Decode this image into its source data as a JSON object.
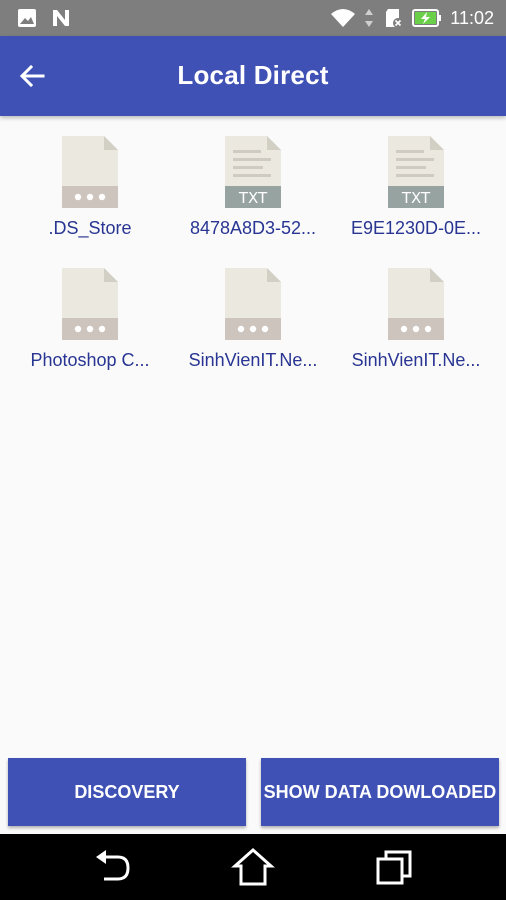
{
  "status_bar": {
    "time": "11:02",
    "icons": [
      "gallery-icon",
      "n-notification-icon",
      "wifi-icon",
      "data-arrows-icon",
      "sd-card-icon",
      "battery-charging-icon"
    ]
  },
  "app_bar": {
    "title": "Local Direct",
    "back_icon": "arrow-back-icon"
  },
  "files": [
    {
      "name": ".DS_Store",
      "type": "generic"
    },
    {
      "name": "8478A8D3-52...",
      "type": "txt",
      "badge": "TXT"
    },
    {
      "name": "E9E1230D-0E...",
      "type": "txt",
      "badge": "TXT"
    },
    {
      "name": "Photoshop C...",
      "type": "generic"
    },
    {
      "name": "SinhVienIT.Ne...",
      "type": "generic"
    },
    {
      "name": "SinhVienIT.Ne...",
      "type": "generic"
    }
  ],
  "buttons": {
    "discovery": "DISCOVERY",
    "show_data": "SHOW DATA DOWLOADED"
  },
  "nav_bar": {
    "icons": [
      "back-nav-icon",
      "home-icon",
      "recents-icon"
    ]
  },
  "colors": {
    "primary": "#3f51b5",
    "file_name": "#283593",
    "status_bar": "#7e7e7e"
  }
}
